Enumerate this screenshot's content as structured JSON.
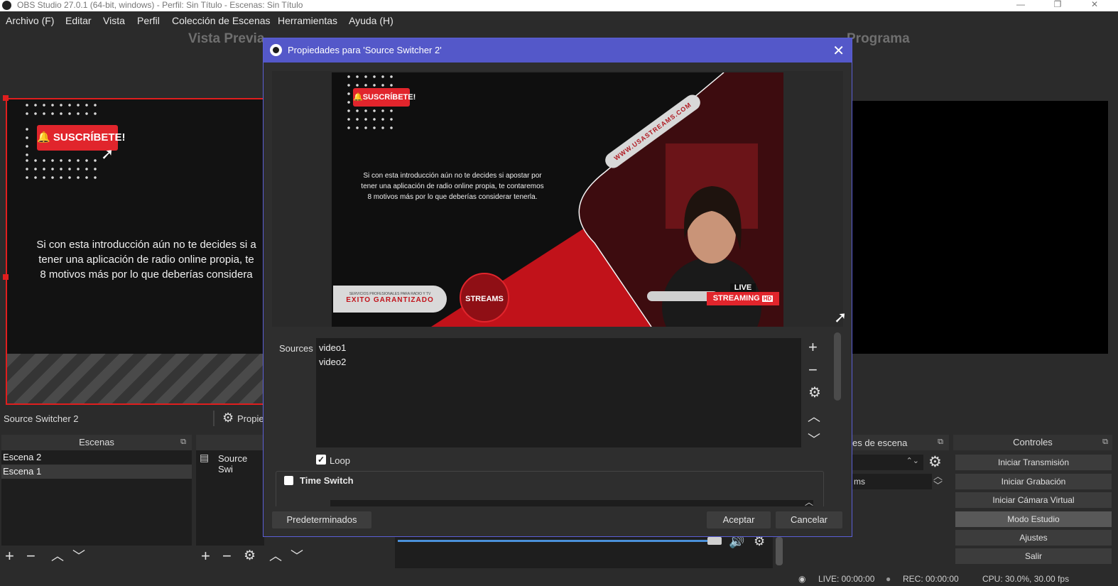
{
  "window": {
    "title": "OBS Studio 27.0.1 (64-bit, windows) - Perfil: Sin Título - Escenas: Sin Título",
    "minimize_glyph": "—",
    "restore_glyph": "❐",
    "close_glyph": "✕"
  },
  "menu": [
    "Archivo (F)",
    "Editar",
    "Vista",
    "Perfil",
    "Colección de Escenas",
    "Herramientas",
    "Ayuda (H)"
  ],
  "preview_label": "Vista Previa",
  "program_label": "Programa",
  "preview": {
    "subscribe": "SUSCRÍBETE!",
    "text_lines": [
      "Si con esta introducción aún no te decides si a",
      "tener una aplicación de radio online propia, te",
      "8 motivos más por lo que deberías considera"
    ]
  },
  "source_bar": {
    "selected_source": "Source Switcher 2",
    "properties_label": "Propie"
  },
  "scenes": {
    "header": "Escenas",
    "items": [
      "Escena 2",
      "Escena 1"
    ]
  },
  "sources": {
    "items": [
      "Source Swi"
    ]
  },
  "transitions": {
    "header_fragment": "es de escena",
    "duration_unit": "ms"
  },
  "controls": {
    "header": "Controles",
    "buttons": [
      "Iniciar Transmisión",
      "Iniciar Grabación",
      "Iniciar Cámara Virtual",
      "Modo Estudio",
      "Ajustes",
      "Salir"
    ]
  },
  "dialog": {
    "title": "Propiedades para 'Source Switcher 2'",
    "sources_label": "Sources",
    "sources_list": [
      "video1",
      "video2"
    ],
    "loop_label": "Loop",
    "loop_checked": true,
    "time_switch_label": "Time Switch",
    "time_switch_checked": false,
    "defaults_button": "Predeterminados",
    "ok_button": "Aceptar",
    "cancel_button": "Cancelar",
    "image": {
      "subscribe": "SUSCRÍBETE!",
      "text_lines": [
        "Si con esta introducción aún no te decides si apostar por",
        "tener una aplicación de radio online propia, te contaremos",
        "8 motivos más por lo que deberías considerar tenerla."
      ],
      "url": "WWW.USASTREAMS.COM",
      "badge_small": "SERVICIOS PROFESIONALES PARA RADIO Y TV",
      "badge_big": "EXITO GARANTIZADO",
      "logo_text": "STREAMS",
      "live": "LIVE",
      "streaming": "STREAMING",
      "hd": "HD"
    }
  },
  "status": {
    "live": "LIVE: 00:00:00",
    "rec": "REC: 00:00:00",
    "cpu": "CPU: 30.0%, 30.00 fps"
  },
  "colors": {
    "accent": "#5458c9",
    "selection": "#e01e1e",
    "brand_red": "#e1252c"
  }
}
